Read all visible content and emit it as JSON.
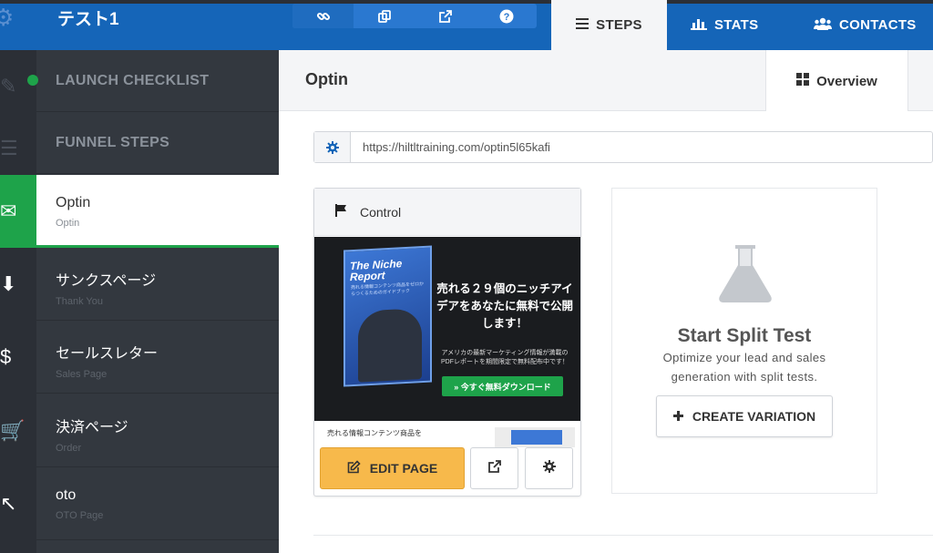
{
  "topbar": {
    "funnel_title": "テスト1",
    "icons": [
      "link-icon",
      "copy-icon",
      "external-link-icon",
      "help-icon"
    ],
    "tabs": [
      {
        "label": "STEPS",
        "icon": "menu-icon",
        "active": true
      },
      {
        "label": "STATS",
        "icon": "bar-chart-icon",
        "active": false
      },
      {
        "label": "CONTACTS",
        "icon": "users-icon",
        "active": false
      }
    ]
  },
  "sidebar": {
    "launch_checklist": "LAUNCH CHECKLIST",
    "funnel_steps": "FUNNEL STEPS",
    "items": [
      {
        "name": "Optin",
        "sub": "Optin",
        "active": true
      },
      {
        "name": "サンクスページ",
        "sub": "Thank You",
        "active": false
      },
      {
        "name": "セールスレター",
        "sub": "Sales Page",
        "active": false
      },
      {
        "name": "決済ページ",
        "sub": "Order",
        "active": false
      },
      {
        "name": "oto",
        "sub": "OTO Page",
        "active": false
      }
    ]
  },
  "main": {
    "title": "Optin",
    "overview_tab": "Overview",
    "url": "https://hiltltraining.com/optin5l65kafi",
    "control": {
      "label": "Control",
      "preview": {
        "book_title": "The Niche Report",
        "book_sub": "売れる情報コンテンツ商品をゼロからつくるためのガイドブック",
        "headline": "売れる２９個のニッチアイデアをあなたに無料で公開します！",
        "small": "アメリカの最新マーケティング情報が満載のPDFレポートを期間限定で無料配布中です！",
        "cta": "» 今すぐ無料ダウンロード",
        "lower_text": "売れる情報コンテンツ商品を"
      },
      "edit_button": "EDIT PAGE"
    },
    "split": {
      "title": "Start Split Test",
      "desc_line1": "Optimize your lead and sales",
      "desc_line2": "generation with split tests.",
      "button": "CREATE VARIATION"
    }
  },
  "colors": {
    "topbar_blue": "#1565b8",
    "sidebar": "#33383f",
    "accent_green": "#1ea34a",
    "edit_orange": "#f7b94b"
  }
}
